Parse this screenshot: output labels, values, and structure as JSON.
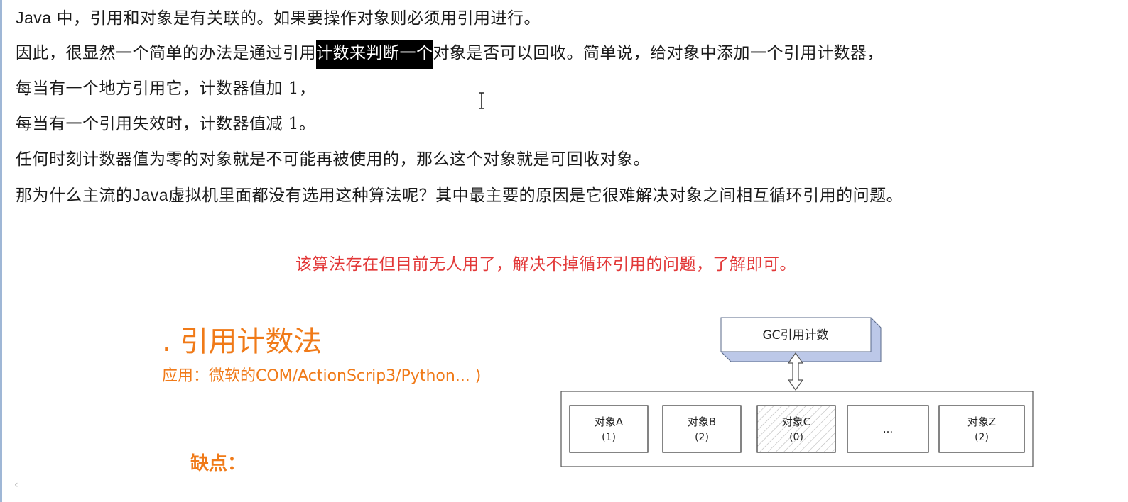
{
  "paragraphs": {
    "p1": "Java 中，引用和对象是有关联的。如果要操作对象则必须用引用进行。",
    "p2_before": "因此，很显然一个简单的办法是通过引用",
    "p2_selected": "计数来判断一个",
    "p2_after": "对象是否可以回收。简单说，给对象中添加一个引用计数器，",
    "p3": "每当有一个地方引用它，计数器值加 1，",
    "p4": "每当有一个引用失效时，计数器值减 1。",
    "p5": "任何时刻计数器值为零的对象就是不可能再被使用的，那么这个对象就是可回收对象。",
    "p6_a": "那为什么主流的",
    "p6_java": "Java",
    "p6_b": "虚拟机里面都没有选用这种算法呢？其中最主要的原因是它很难解决对象之间相互循环引用的问题。"
  },
  "note": {
    "text": "该算法存在但目前无人用了，解决不掉循环引用的问题，了解即可。",
    "color": "#e23838"
  },
  "slide": {
    "title": ". 引用计数法",
    "application": "应用：微软的COM/ActionScrip3/Python... )",
    "drawback_label": "缺点：",
    "accent_color": "#f07a18"
  },
  "diagram": {
    "header": "GC引用计数",
    "objects": [
      {
        "name": "对象A",
        "count": "(1)",
        "collectable": false
      },
      {
        "name": "对象B",
        "count": "(2)",
        "collectable": false
      },
      {
        "name": "对象C",
        "count": "(0)",
        "collectable": true
      },
      {
        "name": "...",
        "count": "",
        "collectable": false
      },
      {
        "name": "对象Z",
        "count": "(2)",
        "collectable": false
      }
    ]
  },
  "icons": {
    "cursor": "text-cursor-icon",
    "scroll": "scroll-left-icon"
  }
}
